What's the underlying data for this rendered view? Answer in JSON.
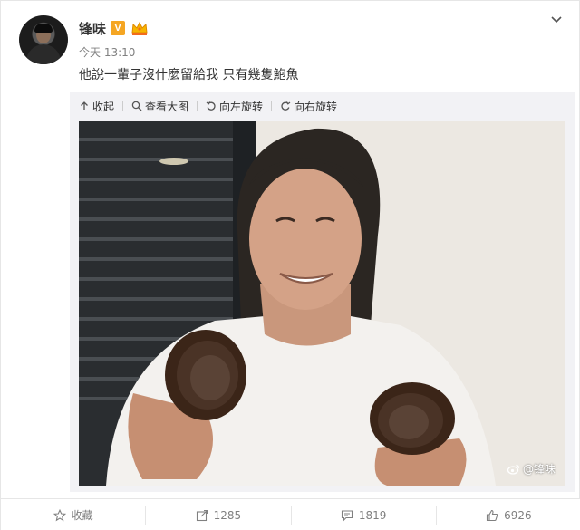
{
  "post": {
    "username": "锋味",
    "verified_badge": "V",
    "timestamp": "今天 13:10",
    "text": "他說一輩子沒什麼留給我 只有幾隻鮑魚"
  },
  "media_toolbar": {
    "collapse_label": "收起",
    "view_large_label": "查看大图",
    "rotate_left_label": "向左旋转",
    "rotate_right_label": "向右旋转"
  },
  "photo": {
    "watermark": "@锋味"
  },
  "actions": {
    "favorite_label": "收藏",
    "repost_count": "1285",
    "comment_count": "1819",
    "like_count": "6926"
  },
  "colors": {
    "text": "#333333",
    "muted": "#808080",
    "verified_badge": "#f5a623",
    "border": "#e6e6e6"
  }
}
